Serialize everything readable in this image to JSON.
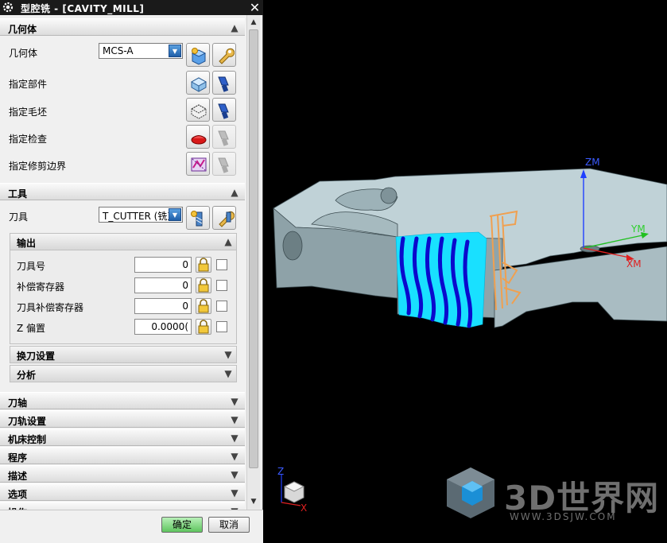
{
  "dialog": {
    "title": "型腔铣 - [CAVITY_MILL]",
    "close_glyph": "✕"
  },
  "geometry_section": {
    "title": "几何体",
    "geometry_label": "几何体",
    "geometry_value": "MCS-A",
    "rows": [
      {
        "label": "指定部件"
      },
      {
        "label": "指定毛坯"
      },
      {
        "label": "指定检查"
      },
      {
        "label": "指定修剪边界"
      }
    ]
  },
  "tool_section": {
    "title": "工具",
    "tool_label": "刀具",
    "tool_value": "T_CUTTER (铣刀",
    "output": {
      "title": "输出",
      "fields": [
        {
          "label": "刀具号",
          "value": "0"
        },
        {
          "label": "补偿寄存器",
          "value": "0"
        },
        {
          "label": "刀具补偿寄存器",
          "value": "0"
        },
        {
          "label": "Z 偏置",
          "value": "0.0000("
        }
      ]
    },
    "tool_change_title": "换刀设置",
    "analysis_title": "分析"
  },
  "collapsed_sections": [
    "刀轴",
    "刀轨设置",
    "机床控制",
    "程序",
    "描述",
    "选项",
    "操作"
  ],
  "buttons": {
    "ok": "确定",
    "cancel": "取消"
  },
  "viewport": {
    "axis_labels": {
      "zm": "ZM",
      "ym": "YM",
      "xm": "XM",
      "z": "Z",
      "x": "X"
    },
    "watermark": {
      "brand": "3D世界网",
      "url": "WWW.3DSJW.COM"
    }
  },
  "colors": {
    "part_face": "#b9ccd1",
    "toolpath_cyan": "#00e5ff",
    "toolpath_blue": "#1010d0",
    "tool_holder_orange": "#f0a050",
    "ok_button": "#7fd87f"
  }
}
